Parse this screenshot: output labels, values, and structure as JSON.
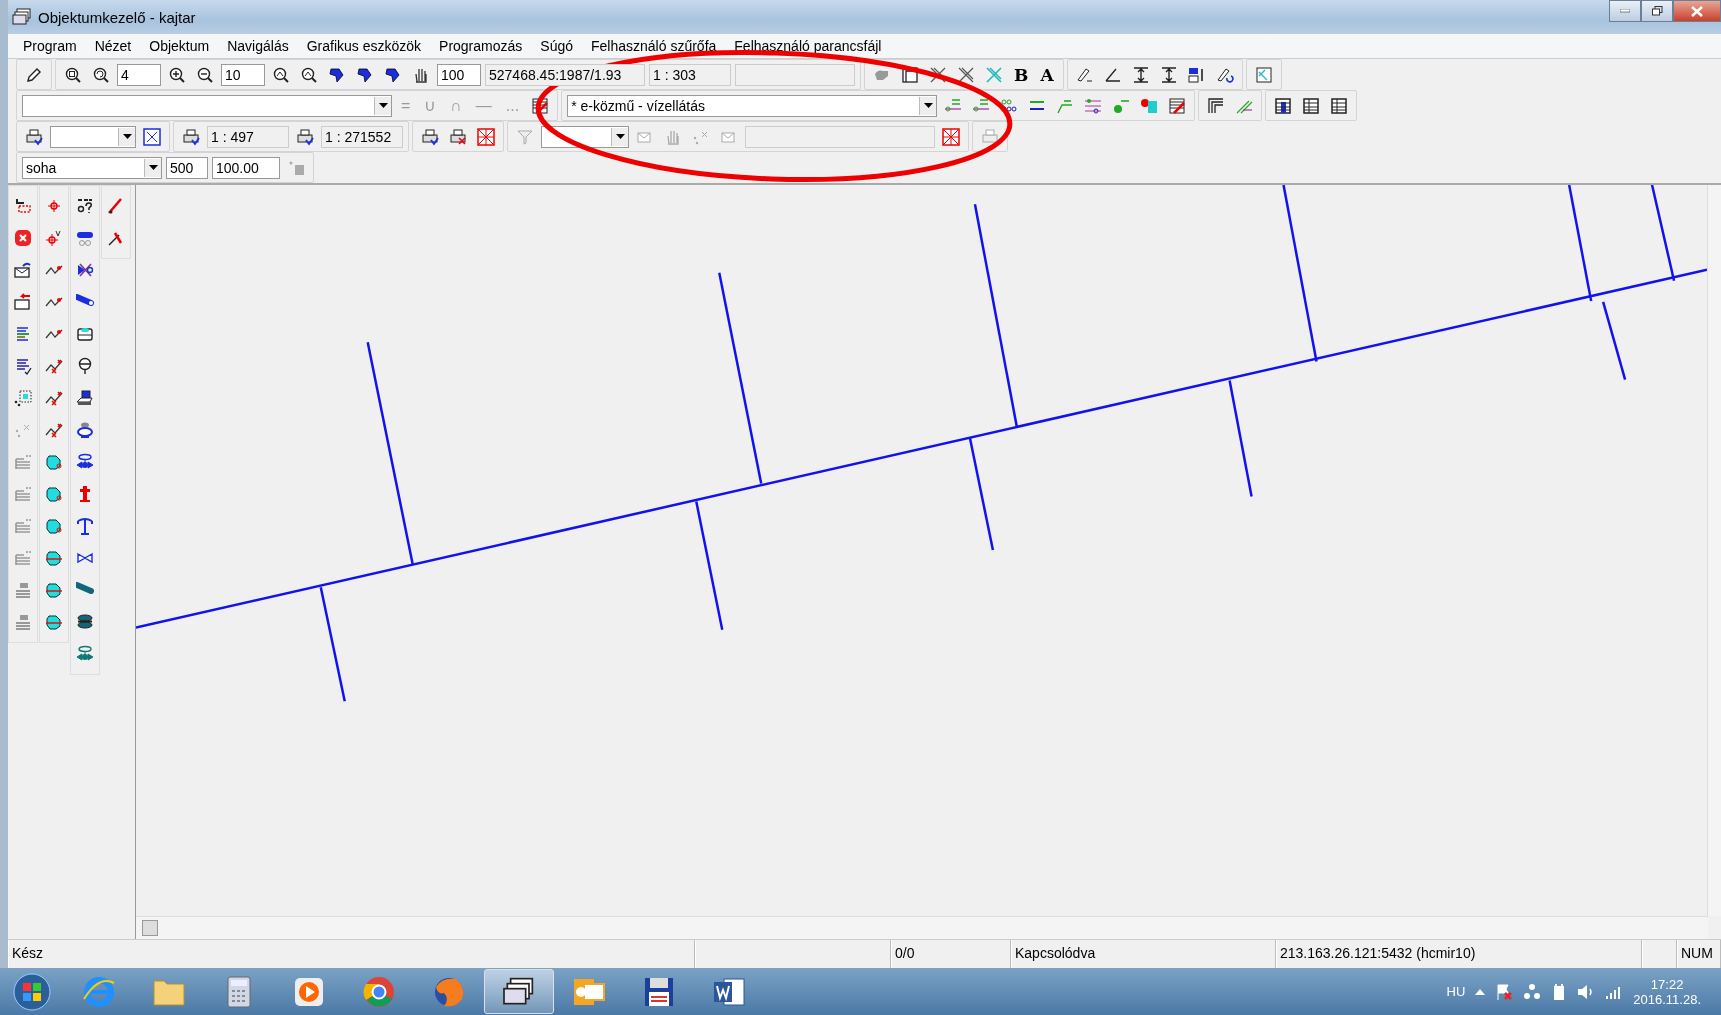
{
  "window": {
    "title": "Objektumkezelő - kajtar"
  },
  "menu": [
    {
      "label": "Program"
    },
    {
      "label": "Nézet"
    },
    {
      "label": "Objektum"
    },
    {
      "label": "Navigálás"
    },
    {
      "label": "Grafikus eszközök"
    },
    {
      "label": "Programozás"
    },
    {
      "label": "Súgó"
    },
    {
      "label": "Felhasználó szűrőfa"
    },
    {
      "label": "Felhasználó parancsfájl"
    }
  ],
  "toolbar_1": {
    "zoom_step": "4",
    "zoom_factor": "10",
    "pan_step": "100",
    "coordinates": "527468.45:1987/1.93",
    "scale": "1 : 303",
    "bold_button": "B",
    "text_button": "A"
  },
  "toolbar_2": {
    "operators": [
      "=",
      "∪",
      "∩",
      "—",
      "..."
    ],
    "layer": "* e-közmű - vízellátás"
  },
  "toolbar_3": {
    "print_scale": "1 : 497",
    "map_scale": "1 : 271552"
  },
  "toolbar_4": {
    "refresh": "soha",
    "value_1": "500",
    "value_2": "100.00"
  },
  "status_bar": {
    "message": "Kész",
    "selection": "0/0",
    "connection": "Kapcsolódva",
    "server": "213.163.26.121:5432 (hcmir10)",
    "keyboard": "NUM"
  },
  "taskbar": {
    "language": "HU",
    "time": "17:22",
    "date": "2016.11.28."
  }
}
